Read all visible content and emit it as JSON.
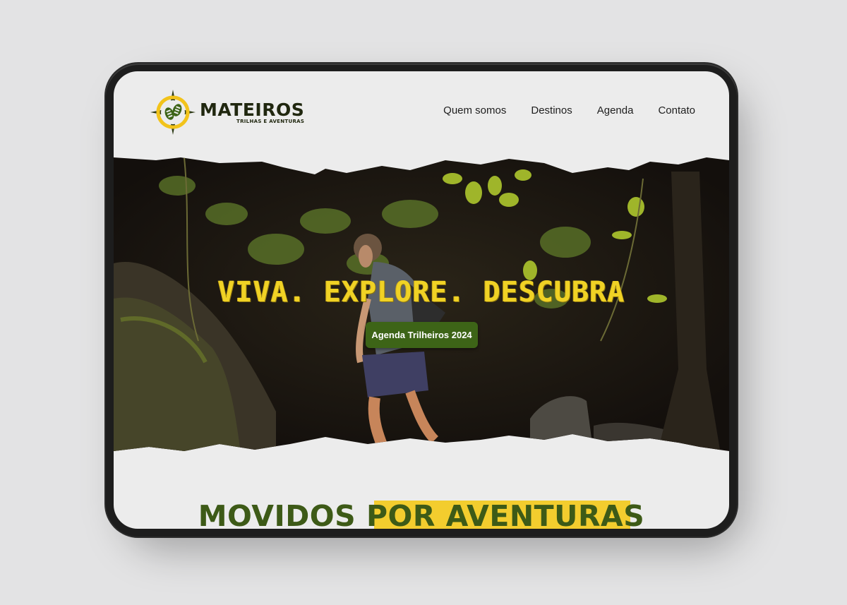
{
  "logo": {
    "title": "MATEIROS",
    "subtitle": "TRILHAS E AVENTURAS",
    "icon": "compass-footprints-icon"
  },
  "nav": {
    "items": [
      {
        "label": "Quem somos"
      },
      {
        "label": "Destinos"
      },
      {
        "label": "Agenda"
      },
      {
        "label": "Contato"
      }
    ]
  },
  "hero": {
    "title": "VIVA. EXPLORE. DESCUBRA",
    "cta_label": "Agenda Trilheiros 2024"
  },
  "section": {
    "heading_part1": "MOVIDOS ",
    "heading_part2": "POR AVENTURAS"
  },
  "colors": {
    "brand_green": "#3d6417",
    "brand_yellow": "#f0d225",
    "highlight_yellow": "#f3cd2e",
    "dark_text": "#20270f",
    "screen_bg": "#ececec"
  }
}
